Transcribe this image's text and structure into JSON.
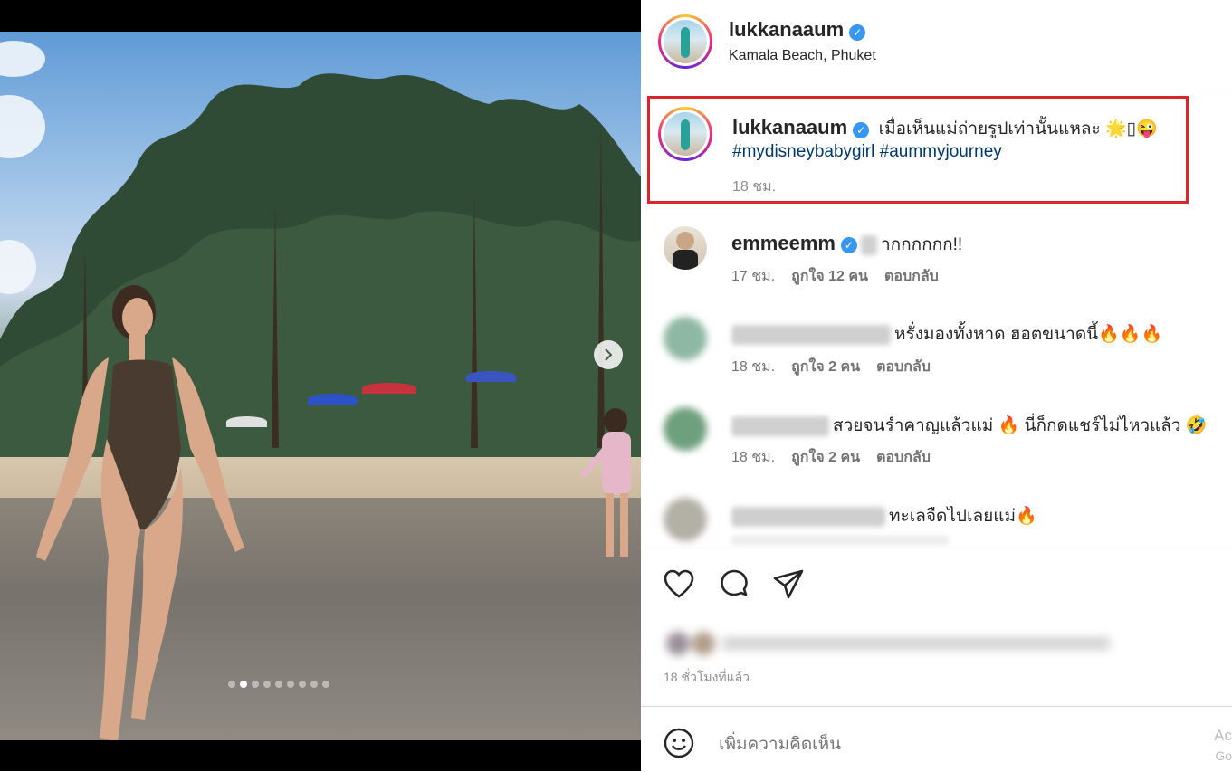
{
  "post": {
    "username": "lukkanaaum",
    "location": "Kamala Beach, Phuket"
  },
  "caption": {
    "username": "lukkanaaum",
    "text": "เมื่อเห็นแม่ถ่ายรูปเท่านั้นแหละ 🌟▯😜",
    "hashtags": "#mydisneybabygirl #aummyjourney",
    "time": "18 ชม."
  },
  "comments": [
    {
      "username": "emmeemm",
      "text": "ากกกกกก!!",
      "time": "17 ชม.",
      "likes": "ถูกใจ 12 คน",
      "reply": "ตอบกลับ"
    },
    {
      "username": "",
      "text": "หรั่งมองทั้งหาด ฮอตขนาดนี้🔥🔥🔥",
      "time": "18 ชม.",
      "likes": "ถูกใจ 2 คน",
      "reply": "ตอบกลับ"
    },
    {
      "username": "",
      "text": "สวยจนรำคาญแล้วแม่ 🔥 นี่ก็กดแชร์ไม่ไหวแล้ว 🤣",
      "time": "18 ชม.",
      "likes": "ถูกใจ 2 คน",
      "reply": "ตอบกลับ"
    },
    {
      "username": "",
      "text": "ทะเลจืดไปเลยแม่🔥"
    }
  ],
  "actions": {
    "icons": [
      "heart-icon",
      "comment-icon",
      "share-icon"
    ],
    "timestamp": "18 ชั่วโมงที่แล้ว"
  },
  "composer": {
    "placeholder": "เพิ่มความคิดเห็น",
    "emoji_icon": "emoji-icon"
  },
  "watermark": {
    "line1": "Ac",
    "line2": "Go"
  },
  "carousel": {
    "count": 9,
    "active": 1
  },
  "colors": {
    "verified": "#3897f0",
    "highlight": "#d9262c",
    "link": "#00376b"
  }
}
